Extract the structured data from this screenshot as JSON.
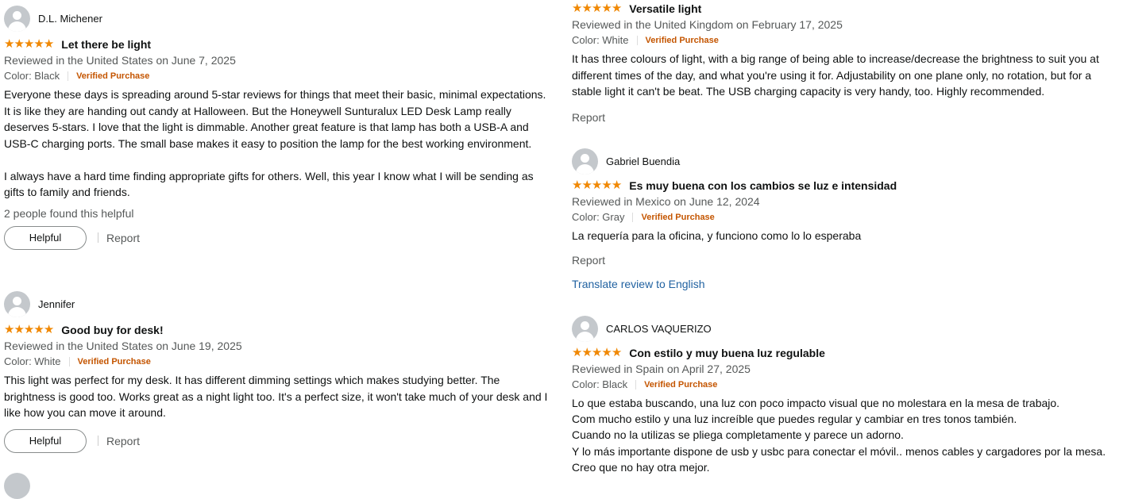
{
  "colors": {
    "star": "#f08804",
    "verified": "#c45500",
    "link": "#2162a1",
    "meta": "#565959"
  },
  "reviews_left": [
    {
      "author": "D.L. Michener",
      "rating": 5,
      "title": "Let there be light",
      "reviewed": "Reviewed in the United States on June 7, 2025",
      "color": "Color: Black",
      "verified": "Verified Purchase",
      "body": [
        "Everyone these days is spreading around 5-star reviews for things that meet their basic, minimal expectations. It is like they are handing out candy at Halloween. But the Honeywell Sunturalux LED Desk Lamp really deserves 5-stars. I love that the light is dimmable. Another great feature is that lamp has both a USB-A and USB-C charging ports. The small base makes it easy to position the lamp for the best working environment.",
        "I always have a hard time finding appropriate gifts for others. Well, this year I know what I will be sending as gifts to family and friends."
      ],
      "helpful_count": "2 people found this helpful",
      "helpful_label": "Helpful",
      "report_label": "Report"
    },
    {
      "author": "Jennifer",
      "rating": 5,
      "title": "Good buy for desk!",
      "reviewed": "Reviewed in the United States on June 19, 2025",
      "color": "Color: White",
      "verified": "Verified Purchase",
      "body": [
        "This light was perfect for my desk. It has different dimming settings which makes studying better. The brightness is good too. Works great as a night light too. It's a perfect size, it won't take much of your desk and I like how you can move it around."
      ],
      "helpful_label": "Helpful",
      "report_label": "Report"
    }
  ],
  "reviews_right": [
    {
      "rating": 5,
      "title": "Versatile light",
      "reviewed": "Reviewed in the United Kingdom on February 17, 2025",
      "color": "Color: White",
      "verified": "Verified Purchase",
      "body": [
        "It has three colours of light, with a big range of being able to increase/decrease the brightness to suit you at different times of the day, and what you're using it for. Adjustability on one plane only, no rotation, but for a stable light it can't be beat. The USB charging capacity is very handy, too. Highly recommended."
      ],
      "report_label": "Report"
    },
    {
      "author": "Gabriel Buendia",
      "rating": 5,
      "title": "Es muy buena con los cambios se luz e intensidad",
      "reviewed": "Reviewed in Mexico on June 12, 2024",
      "color": "Color: Gray",
      "verified": "Verified Purchase",
      "body": [
        "La requería para la oficina, y funciono como lo lo esperaba"
      ],
      "report_label": "Report",
      "translate_label": "Translate review to English"
    },
    {
      "author": "CARLOS VAQUERIZO",
      "rating": 5,
      "title": "Con estilo y muy buena luz regulable",
      "reviewed": "Reviewed in Spain on April 27, 2025",
      "color": "Color: Black",
      "verified": "Verified Purchase",
      "body_lines": [
        "Lo que estaba buscando, una luz con poco impacto visual que no molestara en la mesa de trabajo.",
        "Com mucho estilo y una luz increíble que puedes regular y cambiar en tres tonos también.",
        "Cuando no la utilizas se pliega completamente y parece un adorno.",
        "Y lo más importante dispone de usb y usbc para conectar el móvil.. menos cables y cargadores por la mesa.",
        "Creo que no hay otra mejor."
      ]
    }
  ]
}
